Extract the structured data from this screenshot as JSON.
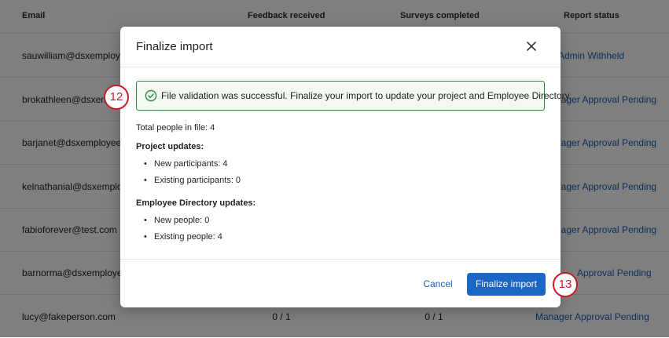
{
  "table": {
    "headers": {
      "email": "Email",
      "feedback": "Feedback received",
      "surveys": "Surveys completed",
      "status": "Report status"
    },
    "rows": [
      {
        "email": "sauwilliam@dsxemployee",
        "feedback": "",
        "surveys": "",
        "status": "Admin Withheld"
      },
      {
        "email": "brokathleen@dsxem",
        "feedback": "",
        "surveys": "",
        "status": "nager Approval Pending"
      },
      {
        "email": "barjanet@dsxemployeete",
        "feedback": "",
        "surveys": "",
        "status": "nager Approval Pending"
      },
      {
        "email": "kelnathanial@dsxemploy",
        "feedback": "",
        "surveys": "",
        "status": "nager Approval Pending"
      },
      {
        "email": "fabioforever@test.com",
        "feedback": "",
        "surveys": "",
        "status": "nager Approval Pending"
      },
      {
        "email": "barnorma@dsxemployee",
        "feedback": "",
        "surveys": "",
        "status": "Approval Pending"
      },
      {
        "email": "lucy@fakeperson.com",
        "feedback": "0 / 1",
        "surveys": "0 / 1",
        "status": "Manager Approval Pending"
      }
    ]
  },
  "modal": {
    "title": "Finalize import",
    "close_icon": "close-icon",
    "alert": {
      "icon": "check-circle-icon",
      "text": "File validation was successful. Finalize your import to update your project and Employee Directory.",
      "color": "#2e8a3f"
    },
    "total_people": "Total people in file: 4",
    "project_updates": {
      "heading": "Project updates:",
      "items": [
        "New participants: 4",
        "Existing participants: 0"
      ]
    },
    "directory_updates": {
      "heading": "Employee Directory updates:",
      "items": [
        "New people: 0",
        "Existing people: 4"
      ]
    },
    "cancel_label": "Cancel",
    "finalize_label": "Finalize import",
    "primary_color": "#1c66c5"
  },
  "callouts": [
    "12",
    "13"
  ],
  "colors": {
    "link": "#1c5fb8",
    "callout": "#c51d2a"
  }
}
